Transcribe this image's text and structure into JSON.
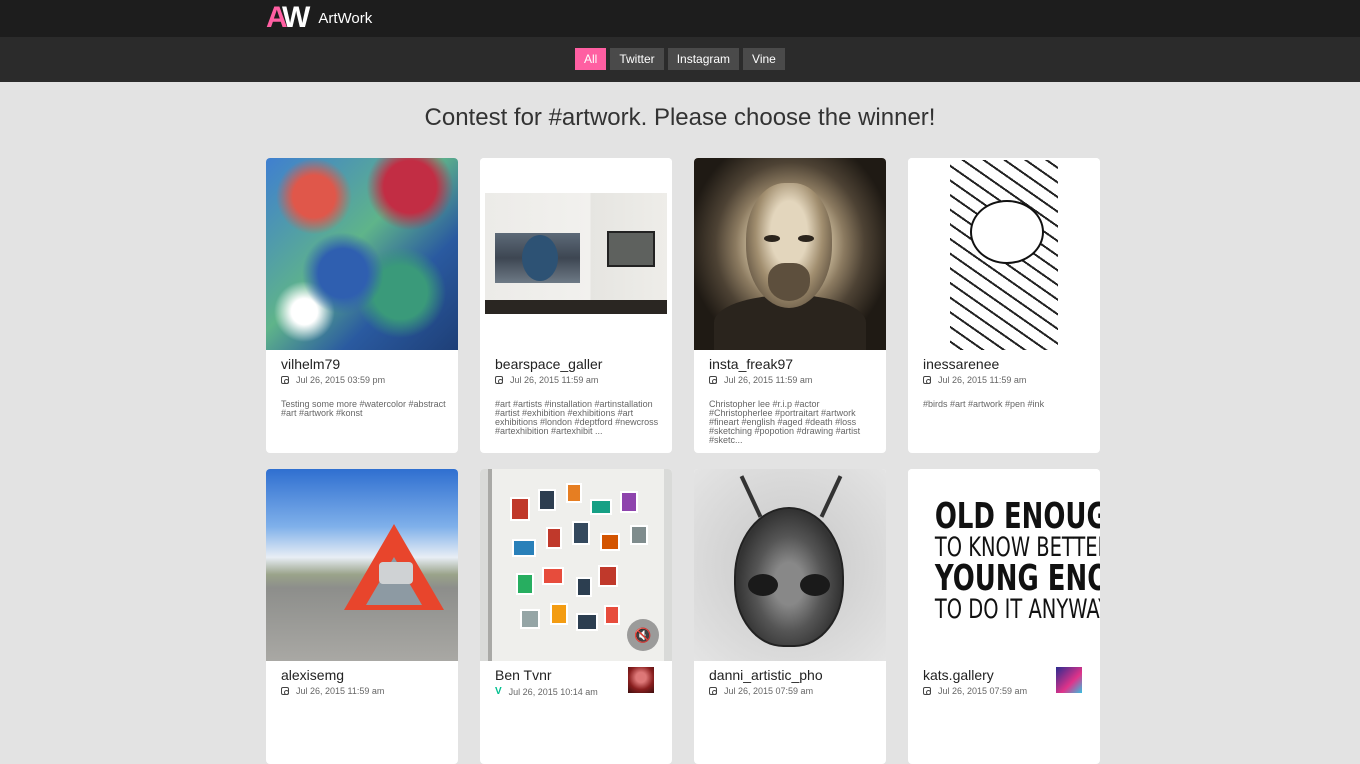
{
  "app": {
    "logo_mark_a": "A",
    "logo_mark_w": "W",
    "name": "ArtWork"
  },
  "filters": [
    "All",
    "Twitter",
    "Instagram",
    "Vine"
  ],
  "heading": "Contest for #artwork. Please choose the winner!",
  "cards": [
    {
      "user": "vilhelm79",
      "source": "instagram",
      "date": "Jul 26, 2015 03:59 pm",
      "caption": "Testing some more #watercolor #abstract #art #artwork #konst"
    },
    {
      "user": "bearspace_galler",
      "source": "instagram",
      "date": "Jul 26, 2015 11:59 am",
      "caption": "#art #artists #installation #artinstallation #artist #exhibition #exhibitions #art exhibitions #london #deptford #newcross #artexhibition #artexhibit ..."
    },
    {
      "user": "insta_freak97",
      "source": "instagram",
      "date": "Jul 26, 2015 11:59 am",
      "caption": "Christopher lee #r.i.p #actor #Christopherlee #portraitart #artwork #fineart #english #aged #death #loss #sketching #popotion #drawing #artist #sketc..."
    },
    {
      "user": "inessarenee",
      "source": "instagram",
      "date": "Jul 26, 2015 11:59 am",
      "caption": "#birds #art #artwork #pen #ink"
    },
    {
      "user": "alexisemg",
      "source": "instagram",
      "date": "Jul 26, 2015 11:59 am",
      "caption": ""
    },
    {
      "user": "Ben Tvnr",
      "source": "vine",
      "date": "Jul 26, 2015 10:14 am",
      "caption": ""
    },
    {
      "user": "danni_artistic_pho",
      "source": "instagram",
      "date": "Jul 26, 2015 07:59 am",
      "caption": ""
    },
    {
      "user": "kats.gallery",
      "source": "instagram",
      "date": "Jul 26, 2015 07:59 am",
      "caption": ""
    }
  ],
  "quote_image": {
    "line1": "OLD ENOUGH",
    "line2": "TO KNOW BETTER",
    "line3": "YOUNG ENOUGH",
    "line4": "TO DO IT ANYWAY"
  },
  "vine_icon": "V",
  "mute_icon": "🔇",
  "colors": {
    "accent": "#ff5fa2",
    "topbar": "#1d1d1d",
    "filterbar": "#2b2b2b",
    "background": "#e3e3e3",
    "vine": "#00bf8f"
  },
  "icons": {
    "instagram": "instagram-icon",
    "vine": "vine-icon",
    "mute": "mute-icon"
  }
}
